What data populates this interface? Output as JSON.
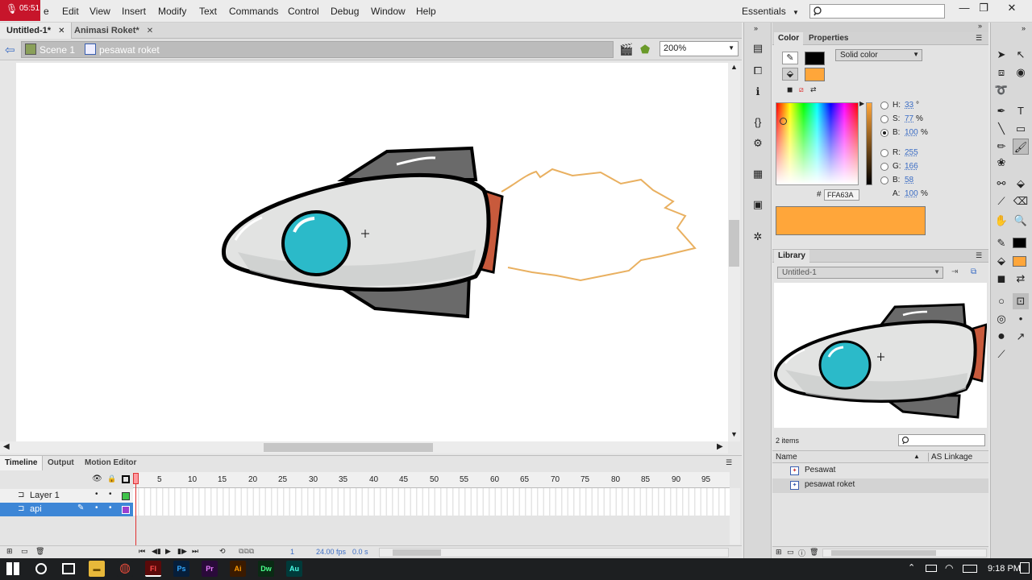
{
  "recording": {
    "time": "05:51"
  },
  "menu": {
    "items": [
      "Edit",
      "View",
      "Insert",
      "Modify",
      "Text",
      "Commands",
      "Control",
      "Debug",
      "Window",
      "Help"
    ],
    "partial_file": "e"
  },
  "workspace": {
    "label": "Essentials"
  },
  "tabs": [
    {
      "label": "Untitled-1*",
      "active": true
    },
    {
      "label": "Animasi Roket*",
      "active": false
    }
  ],
  "breadcrumb": {
    "scene": "Scene 1",
    "symbol": "pesawat roket"
  },
  "zoom": {
    "value": "200%"
  },
  "timeline": {
    "tabs": [
      "Timeline",
      "Output",
      "Motion Editor"
    ],
    "frame_numbers": [
      "1",
      "5",
      "10",
      "15",
      "20",
      "25",
      "30",
      "35",
      "40",
      "45",
      "50",
      "55",
      "60",
      "65",
      "70",
      "75",
      "80",
      "85",
      "90",
      "95"
    ],
    "layers": [
      {
        "name": "Layer 1",
        "selected": false
      },
      {
        "name": "api",
        "selected": true
      }
    ],
    "current_frame": "1",
    "fps": "24.00 fps",
    "time": "0.0 s"
  },
  "color_panel": {
    "tabs": [
      "Color",
      "Properties"
    ],
    "fill_type": "Solid color",
    "h": {
      "label": "H:",
      "value": "33",
      "unit": "°"
    },
    "s": {
      "label": "S:",
      "value": "77",
      "unit": "%"
    },
    "b": {
      "label": "B:",
      "value": "100",
      "unit": "%"
    },
    "r": {
      "label": "R:",
      "value": "255"
    },
    "g": {
      "label": "G:",
      "value": "166"
    },
    "bl": {
      "label": "B:",
      "value": "58"
    },
    "a": {
      "label": "A:",
      "value": "100",
      "unit": "%"
    },
    "hex_prefix": "#",
    "hex": "FFA63A",
    "colors": {
      "fill": "#ffa63a",
      "stroke": "#000000"
    }
  },
  "library": {
    "title": "Library",
    "document": "Untitled-1",
    "count": "2 items",
    "col_name": "Name",
    "col_linkage": "AS Linkage",
    "items": [
      {
        "name": "Pesawat"
      },
      {
        "name": "pesawat roket"
      }
    ]
  },
  "taskbar": {
    "apps": [
      "Fl",
      "Ps",
      "Pr",
      "Ai",
      "Dw",
      "Au"
    ],
    "clock": "9:18 PM"
  }
}
